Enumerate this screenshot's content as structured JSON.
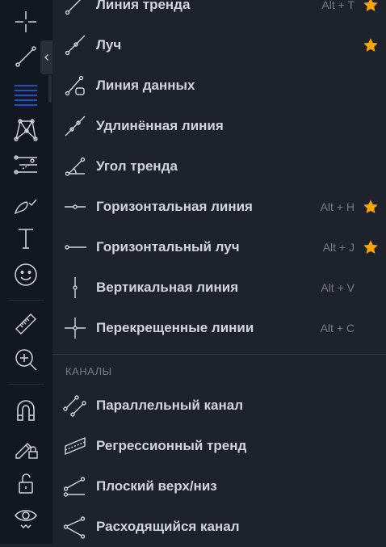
{
  "menu": {
    "items": [
      {
        "label": "Линия тренда",
        "hotkey": "Alt + T",
        "favorite": true,
        "icon": "trend-line-icon"
      },
      {
        "label": "Луч",
        "hotkey": "",
        "favorite": true,
        "icon": "ray-icon"
      },
      {
        "label": "Линия данных",
        "hotkey": "",
        "favorite": false,
        "icon": "info-line-icon"
      },
      {
        "label": "Удлинённая линия",
        "hotkey": "",
        "favorite": false,
        "icon": "extended-line-icon"
      },
      {
        "label": "Угол тренда",
        "hotkey": "",
        "favorite": false,
        "icon": "trend-angle-icon"
      },
      {
        "label": "Горизонтальная линия",
        "hotkey": "Alt + H",
        "favorite": true,
        "icon": "horizontal-line-icon"
      },
      {
        "label": "Горизонтальный луч",
        "hotkey": "Alt + J",
        "favorite": true,
        "icon": "horizontal-ray-icon"
      },
      {
        "label": "Вертикальная линия",
        "hotkey": "Alt + V",
        "favorite": false,
        "icon": "vertical-line-icon"
      },
      {
        "label": "Перекрещенные линии",
        "hotkey": "Alt + C",
        "favorite": false,
        "icon": "cross-line-icon"
      }
    ],
    "channels_header": "КАНАЛЫ",
    "channels": [
      {
        "label": "Параллельный канал",
        "icon": "parallel-channel-icon"
      },
      {
        "label": "Регрессионный тренд",
        "icon": "regression-trend-icon"
      },
      {
        "label": "Плоский верх/низ",
        "icon": "flat-top-bottom-icon"
      },
      {
        "label": "Расходящийся канал",
        "icon": "disjoint-channel-icon"
      }
    ]
  },
  "toolbar": {
    "tools": [
      "crosshair-icon",
      "trend-line-icon",
      "fib-retracement-icon",
      "xabcd-pattern-icon",
      "prediction-icon",
      "brush-icon",
      "text-icon",
      "emoji-icon",
      "ruler-icon",
      "zoom-in-icon",
      "magnet-icon",
      "lock-drawing-icon",
      "unlock-icon",
      "eye-icon"
    ]
  },
  "colors": {
    "background": "#1e222d",
    "toolbar": "#131722",
    "accent": "#2962ff",
    "star": "#f7a600",
    "text": "#d1d4dc",
    "muted": "#787b86"
  }
}
